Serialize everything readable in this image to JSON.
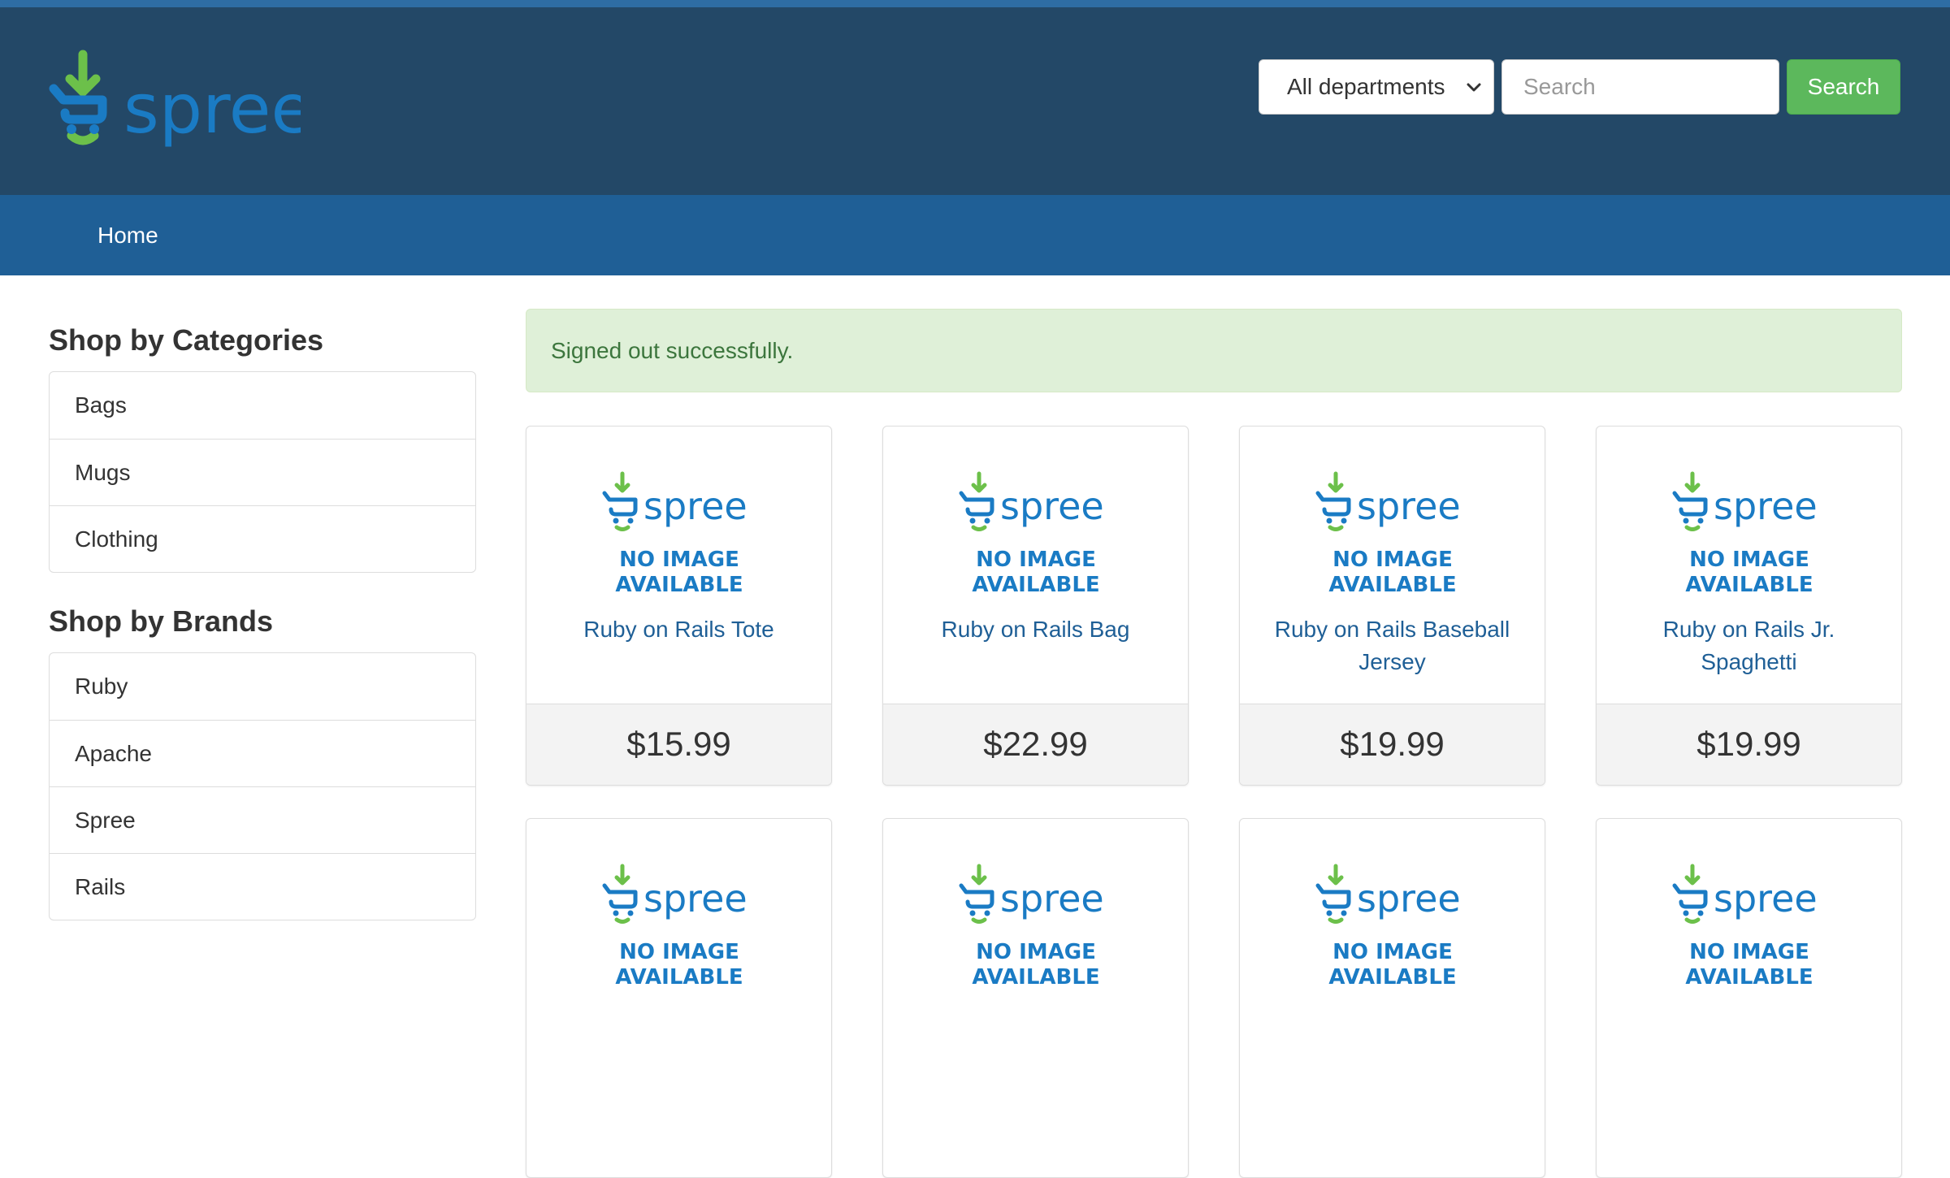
{
  "header": {
    "logo_text": "spree",
    "department_select": {
      "selected": "All departments",
      "options": [
        "All departments"
      ]
    },
    "search": {
      "placeholder": "Search",
      "value": ""
    },
    "search_button_label": "Search"
  },
  "nav": {
    "home_label": "Home"
  },
  "sidebar": {
    "categories_title": "Shop by Categories",
    "categories": [
      "Bags",
      "Mugs",
      "Clothing"
    ],
    "brands_title": "Shop by Brands",
    "brands": [
      "Ruby",
      "Apache",
      "Spree",
      "Rails"
    ]
  },
  "flash": {
    "message": "Signed out successfully."
  },
  "products": {
    "placeholder": {
      "brand": "spree",
      "line1": "NO IMAGE",
      "line2": "AVAILABLE"
    },
    "items": [
      {
        "name": "Ruby on Rails Tote",
        "price": "$15.99"
      },
      {
        "name": "Ruby on Rails Bag",
        "price": "$22.99"
      },
      {
        "name": "Ruby on Rails Baseball Jersey",
        "price": "$19.99"
      },
      {
        "name": "Ruby on Rails Jr. Spaghetti",
        "price": "$19.99"
      },
      {
        "name": "",
        "price": ""
      },
      {
        "name": "",
        "price": ""
      },
      {
        "name": "",
        "price": ""
      },
      {
        "name": "",
        "price": ""
      }
    ]
  },
  "colors": {
    "header_bg": "#234867",
    "nav_bg": "#1f5f96",
    "brand_blue": "#1a7bc4",
    "brand_green": "#6cc04a",
    "search_button": "#5cb85c",
    "alert_bg": "#dff0d8",
    "alert_text": "#3c763d",
    "link": "#1f5f96"
  }
}
